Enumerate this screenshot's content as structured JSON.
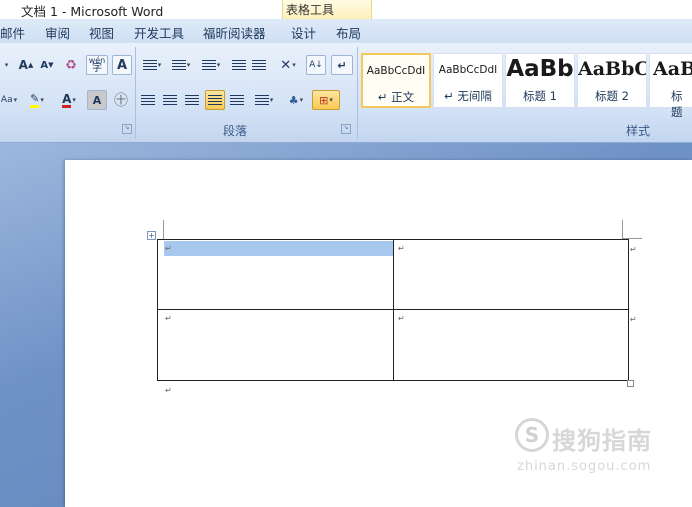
{
  "window": {
    "title": "文档 1 - Microsoft Word",
    "context_tab": "表格工具"
  },
  "menu": {
    "tabs": [
      "邮件",
      "审阅",
      "视图",
      "开发工具",
      "福昕阅读器",
      "设计",
      "布局"
    ]
  },
  "ribbon": {
    "font_group": {
      "grow": "A",
      "shrink": "A",
      "pinyin": "wén",
      "text_a": "A",
      "font_color": "A"
    },
    "groups": {
      "paragraph": "段落",
      "styles": "样式"
    },
    "styles": [
      {
        "sample": "AaBbCcDdI",
        "name": "↵ 正文",
        "selected": true
      },
      {
        "sample": "AaBbCcDdI",
        "name": "↵ 无间隔",
        "selected": false
      },
      {
        "sample": "AaBb",
        "name": "标题 1",
        "selected": false
      },
      {
        "sample": "AaBbC",
        "name": "标题 2",
        "selected": false
      },
      {
        "sample": "AaB",
        "name": "标题",
        "selected": false
      }
    ]
  },
  "document": {
    "paragraph_mark": "↵",
    "table": {
      "rows": 2,
      "cols": 2
    }
  },
  "watermark": {
    "logo": "S",
    "text": "搜狗指南",
    "url": "zhinan.sogou.com"
  }
}
